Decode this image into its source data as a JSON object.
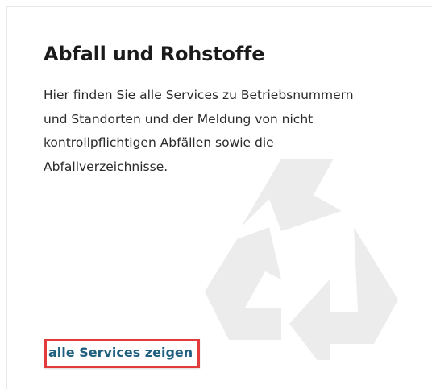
{
  "card": {
    "title": "Abfall und Rohstoffe",
    "description_lines": [
      "Hier finden Sie alle Services zu Betriebsnummern",
      "und Standorten und der Meldung von nicht",
      "kontrollpflichtigen Abfällen sowie die",
      "Abfallverzeichnisse."
    ],
    "watermark_icon": "recycle-icon",
    "link_label": "alle Services zeigen"
  },
  "colors": {
    "title": "#1b1b1b",
    "text": "#2a2a2a",
    "link": "#1f5f80",
    "highlight_border": "#e23b3b",
    "watermark": "#ececec"
  }
}
